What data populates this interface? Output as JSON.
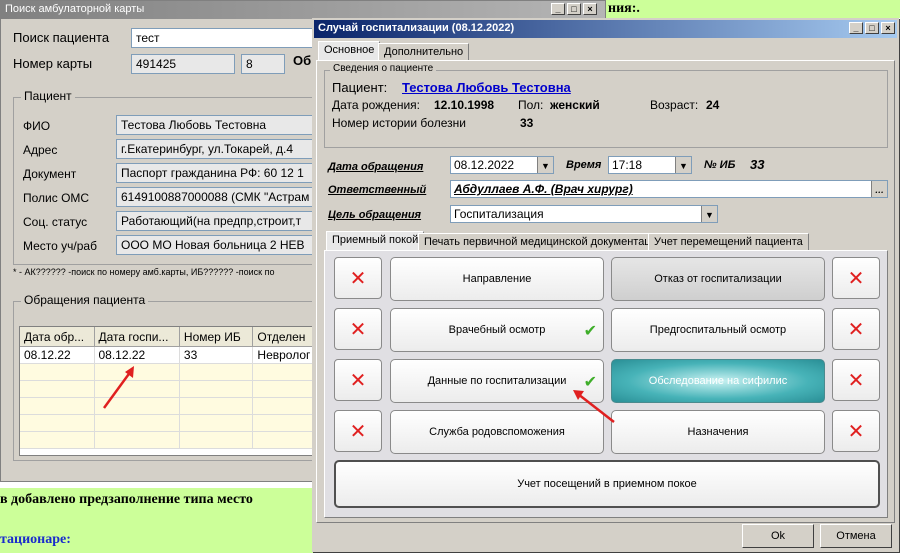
{
  "background": {
    "top_text": "ния:.",
    "bottom_text1": "в добавлено предзаполнение типа место",
    "bottom_text2": "тационаре:"
  },
  "search_window": {
    "title": "Поиск амбулаторной карты",
    "search_label": "Поиск пациента",
    "search_value": "тест",
    "card_label": "Номер карты",
    "card_value": "491425",
    "card_value2": "8",
    "card_value3": "Об",
    "patient_group": "Пациент",
    "fio_label": "ФИО",
    "fio_value": "Тестова Любовь Тестовна",
    "address_label": "Адрес",
    "address_value": "г.Екатеринбург, ул.Токарей, д.4",
    "doc_label": "Документ",
    "doc_value": "Паспорт гражданина РФ: 60 12 1",
    "oms_label": "Полис ОМС",
    "oms_value": "6149100887000088 (СМК \"Астрам",
    "soc_label": "Соц. статус",
    "soc_value": "Работающий(на предпр,строит,т",
    "work_label": "Место уч/раб",
    "work_value": "ООО МО Новая больница 2 НЕВ",
    "hint": "* - АК?????? -поиск по номеру амб.карты, ИБ?????? -поиск по",
    "visits_group": "Обращения пациента",
    "table": {
      "headers": [
        "Дата обр...",
        "Дата госпи...",
        "Номер ИБ",
        "Отделен"
      ],
      "rows": [
        [
          "08.12.22",
          "08.12.22",
          "33",
          "Невролог"
        ]
      ]
    }
  },
  "dialog": {
    "title": "Случай госпитализации (08.12.2022)",
    "tabs": [
      "Основное",
      "Дополнительно"
    ],
    "info_group": "Сведения о пациенте",
    "patient_label": "Пациент:",
    "patient_name": "Тестова Любовь Тестовна",
    "birth_label": "Дата рождения:",
    "birth_value": "12.10.1998",
    "sex_label": "Пол:",
    "sex_value": "женский",
    "age_label": "Возраст:",
    "age_value": "24",
    "history_label": "Номер истории болезни",
    "history_value": "33",
    "date_label": "Дата обращения",
    "date_value": "08.12.2022",
    "time_label": "Время",
    "time_value": "17:18",
    "ib_label": "№ ИБ",
    "ib_value": "33",
    "responsible_label": "Ответственный",
    "responsible_value": "Абдуллаев А.Ф. (Врач хирург)",
    "purpose_label": "Цель обращения",
    "purpose_value": "Госпитализация",
    "inner_tabs": [
      "Приемный покой",
      "Печать первичной медицинской документации",
      "Учет перемещений пациента"
    ],
    "buttons": {
      "direction": "Направление",
      "refusal": "Отказ от госпитализации",
      "exam": "Врачебный осмотр",
      "preexam": "Предгоспитальный осмотр",
      "hospdata": "Данные по госпитализации",
      "syphilis": "Обследование на сифилис",
      "obstetric": "Служба родовспоможения",
      "prescriptions": "Назначения",
      "visits": "Учет посещений в приемном покое"
    },
    "ok": "Ok",
    "cancel": "Отмена"
  }
}
